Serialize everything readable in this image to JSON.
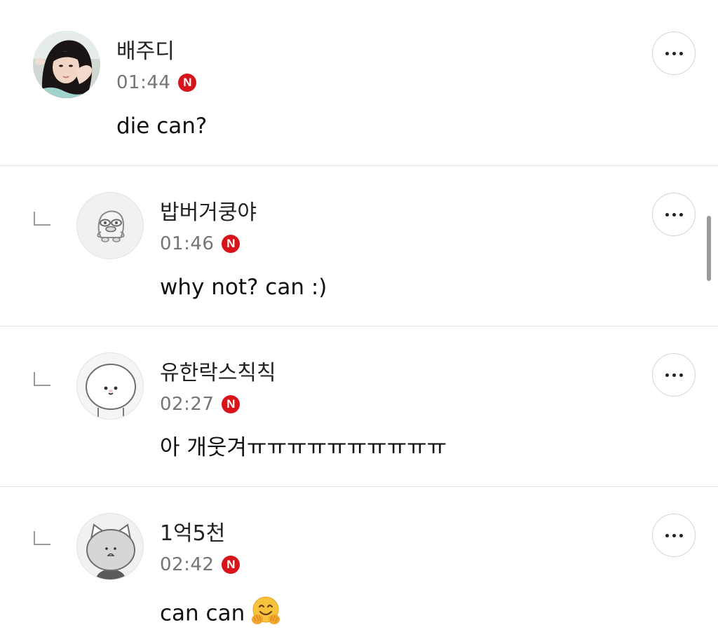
{
  "comments": [
    {
      "nickname": "배주디",
      "time": "01:44",
      "badge": "N",
      "text": "die can?",
      "is_reply": false,
      "avatar": "photo-avatar-woman",
      "more_icon": "more-dots-icon"
    },
    {
      "nickname": "밥버거쿵야",
      "time": "01:46",
      "badge": "N",
      "text": "why not? can :)",
      "is_reply": true,
      "avatar": "duck-character-stamp",
      "more_icon": "more-dots-icon"
    },
    {
      "nickname": "유한락스칙칙",
      "time": "02:27",
      "badge": "N",
      "text": "아 개웃겨ㅠㅠㅠㅠㅠㅠㅠㅠㅠㅠ",
      "is_reply": true,
      "avatar": "round-face-character-stamp",
      "more_icon": "more-dots-icon"
    },
    {
      "nickname": "1억5천",
      "time": "02:42",
      "badge": "N",
      "text": "can can",
      "emoji": "hugging-face-emoji",
      "is_reply": true,
      "avatar": "cat-character-stamp",
      "more_icon": "more-dots-icon"
    }
  ],
  "colors": {
    "badge_red": "#d8131a",
    "divider": "#e4e4e4",
    "time_gray": "#757575",
    "text": "#111111"
  }
}
